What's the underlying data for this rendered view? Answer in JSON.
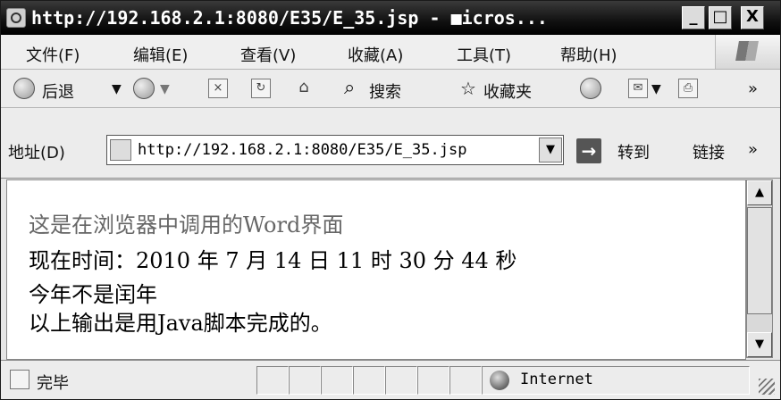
{
  "window": {
    "title": "http://192.168.2.1:8080/E35/E_35.jsp - ■icros...",
    "controls": {
      "minimize": "_",
      "maximize": "□",
      "close": "X"
    }
  },
  "menubar": {
    "items": [
      {
        "label": "文件(F)"
      },
      {
        "label": "编辑(E)"
      },
      {
        "label": "查看(V)"
      },
      {
        "label": "收藏(A)"
      },
      {
        "label": "工具(T)"
      },
      {
        "label": "帮助(H)"
      }
    ]
  },
  "toolbar": {
    "back_label": "后退",
    "search_label": "搜索",
    "favorites_label": "收藏夹",
    "more": "»"
  },
  "addressbar": {
    "label": "地址(D)",
    "url": "http://192.168.2.1:8080/E35/E_35.jsp",
    "go_label": "转到",
    "links_label": "链接",
    "more": "»"
  },
  "content": {
    "lines": [
      "这是在浏览器中调用的Word界面",
      "现在时间：2010 年 7 月 14 日 11 时 30 分 44 秒",
      "今年不是闰年",
      "以上输出是用Java脚本完成的。"
    ]
  },
  "statusbar": {
    "status": "完毕",
    "zone": "Internet"
  },
  "icons": {
    "ie_page": "ie-page-icon",
    "back": "back-arrow-icon",
    "forward": "forward-arrow-icon",
    "stop": "stop-icon",
    "refresh": "refresh-icon",
    "home": "home-icon",
    "search": "search-icon",
    "favorites": "star-icon",
    "history": "history-icon",
    "mail": "mail-icon",
    "print": "print-icon",
    "go": "go-arrow-icon",
    "globe": "globe-icon"
  }
}
